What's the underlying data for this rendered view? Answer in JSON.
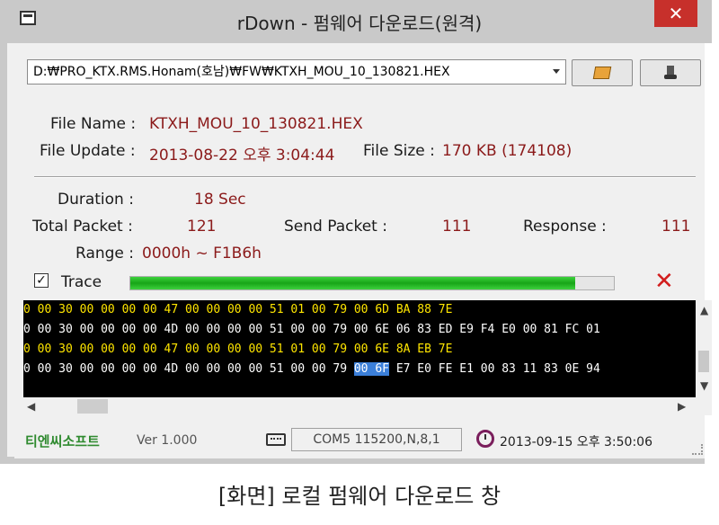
{
  "window": {
    "title": "rDown - 펌웨어 다운로드(원격)",
    "close_glyph": "✕"
  },
  "file": {
    "path": "D:₩PRO_KTX.RMS.Honam(호남)₩FW₩KTXH_MOU_10_130821.HEX",
    "name_label": "File Name :",
    "name_value": "KTXH_MOU_10_130821.HEX",
    "update_label": "File Update :",
    "update_value": "2013-08-22 오후 3:04:44",
    "size_label": "File Size :",
    "size_value": "170 KB (174108)"
  },
  "toolbar": {
    "open_icon": "folder-icon",
    "download_icon": "download-device-icon"
  },
  "stats": {
    "duration_label": "Duration :",
    "duration_value": "18  Sec",
    "total_label": "Total Packet :",
    "total_value": "121",
    "send_label": "Send Packet :",
    "send_value": "111",
    "response_label": "Response :",
    "response_value": "111",
    "range_label": "Range :",
    "range_value": "0000h ~ F1B6h"
  },
  "trace": {
    "label": "Trace",
    "checked_glyph": "✓",
    "progress": 0.92,
    "cancel_glyph": "✕"
  },
  "hex_lines": [
    {
      "text": "0 00 30 00 00 00 00 47 00 00 00 00 51 01 00 79 00 6D BA 88 7E",
      "color": "#ffe600"
    },
    {
      "text": "0 00 30 00 00 00 00 4D 00 00 00 00 51 00 00 79 00 6E 06 83 ED E9 F4 E0 00 81 FC 01",
      "color": "#ffffff"
    },
    {
      "text": "0 00 30 00 00 00 00 47 00 00 00 00 51 01 00 79 00 6E 8A EB 7E",
      "color": "#ffe600"
    },
    {
      "text_before": "0 00 30 00 00 00 00 4D 00 00 00 00 51 00 00 79 ",
      "highlight": "00 6F",
      "text_after": " E7 E0 FE E1 00 83 11 83 0E 94",
      "color": "#ffffff"
    }
  ],
  "status": {
    "brand": "티엔씨소프트",
    "version": "Ver 1.000",
    "com": "COM5 115200,N,8,1",
    "datetime": "2013-09-15 오후 3:50:06"
  },
  "caption": "[화면]  로컬 펌웨어 다운로드 창",
  "colors": {
    "accent_red": "#8b1a1a",
    "progress_green": "#17a517",
    "hex_yellow": "#ffe600",
    "highlight_blue": "#3b7fd9"
  }
}
